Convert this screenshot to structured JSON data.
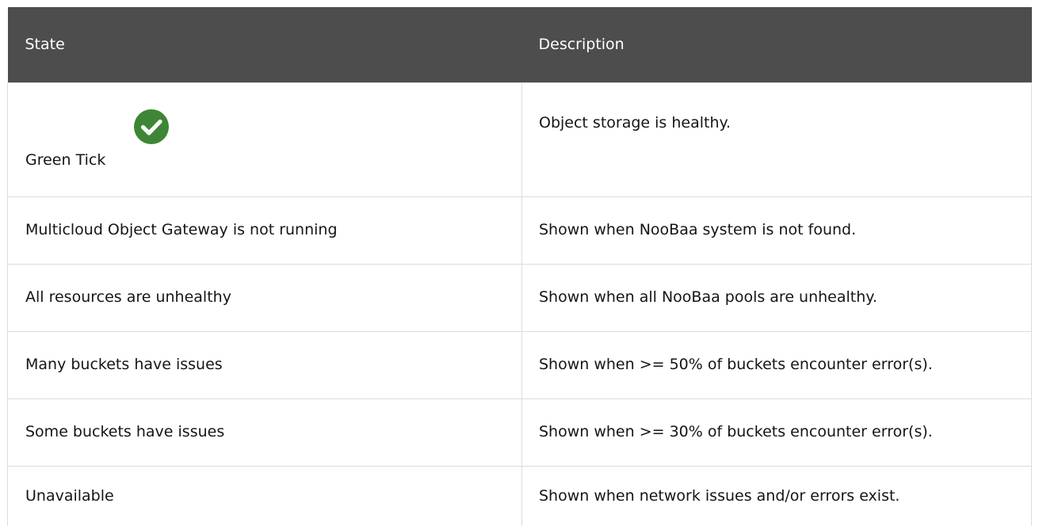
{
  "table": {
    "headers": {
      "state": "State",
      "description": "Description"
    },
    "rows": [
      {
        "state": "Green Tick",
        "description": "Object storage is healthy.",
        "icon": "green-check-circle-icon",
        "icon_color": "#3e8635"
      },
      {
        "state": "Multicloud Object Gateway is not running",
        "description": "Shown when NooBaa system is not found."
      },
      {
        "state": "All resources are unhealthy",
        "description": "Shown when all NooBaa pools are unhealthy."
      },
      {
        "state": "Many buckets have issues",
        "description": "Shown when >= 50% of buckets encounter error(s)."
      },
      {
        "state": "Some buckets have issues",
        "description": "Shown when >= 30% of buckets encounter error(s)."
      },
      {
        "state": "Unavailable",
        "description": "Shown when network issues and/or errors exist."
      }
    ]
  },
  "colors": {
    "header_bg": "#4d4d4d",
    "header_text": "#ffffff",
    "border": "#dcdcdc",
    "tick_green": "#3e8635"
  }
}
